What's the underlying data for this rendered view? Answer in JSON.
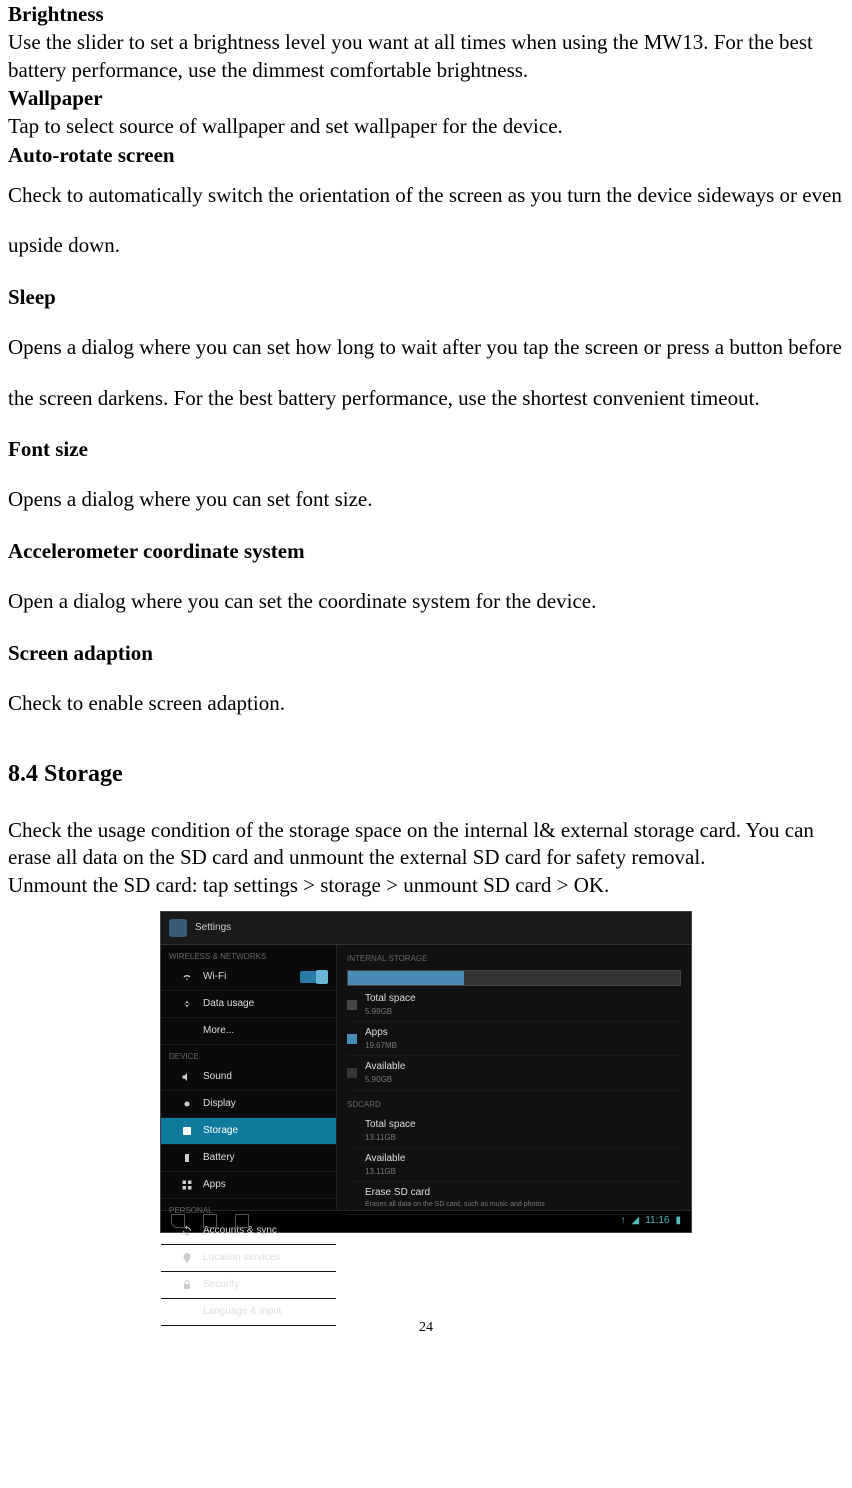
{
  "sections": {
    "brightness": {
      "title": "Brightness",
      "body": "Use the slider to set a brightness level you want at all times when using the MW13. For the best battery performance, use the dimmest comfortable brightness."
    },
    "wallpaper": {
      "title": "Wallpaper",
      "body": "Tap to select source of wallpaper and set wallpaper for the device."
    },
    "auto_rotate": {
      "title": "Auto-rotate screen",
      "body": "Check to automatically switch the orientation of the screen as you turn the device sideways or even upside down."
    },
    "sleep": {
      "title": "Sleep",
      "body": "Opens a dialog where you can set how long to wait after you tap the screen or press a button before the screen darkens. For the best battery performance, use the shortest convenient timeout."
    },
    "font_size": {
      "title": "Font size",
      "body": "Opens a dialog where you can set font size."
    },
    "accel": {
      "title": "Accelerometer coordinate system",
      "body": "Open a dialog where you can set the coordinate system for the device."
    },
    "screen_adaption": {
      "title": "Screen adaption",
      "body": "Check to enable screen adaption."
    }
  },
  "storage": {
    "heading": "8.4 Storage",
    "body": "Check the usage condition of the storage space on the internal l& external storage card. You can erase all data on the SD card and unmount the external SD card for safety removal.",
    "unmount": "Unmount the SD card: tap settings > storage > unmount SD card > OK."
  },
  "screenshot": {
    "header_title": "Settings",
    "sidebar": {
      "cat_wireless": "WIRELESS & NETWORKS",
      "wifi": "Wi-Fi",
      "data_usage": "Data usage",
      "more": "More...",
      "cat_device": "DEVICE",
      "sound": "Sound",
      "display": "Display",
      "storage": "Storage",
      "battery": "Battery",
      "apps": "Apps",
      "cat_personal": "PERSONAL",
      "accounts": "Accounts & sync",
      "location": "Location services",
      "security": "Security",
      "language": "Language & input"
    },
    "main": {
      "cat_internal": "INTERNAL STORAGE",
      "total_label": "Total space",
      "total_value": "5.99GB",
      "apps_label": "Apps",
      "apps_value": "19.67MB",
      "available_label": "Available",
      "available_value": "5.90GB",
      "cat_sdcard": "SDCARD",
      "sd_total_label": "Total space",
      "sd_total_value": "13.11GB",
      "sd_available_label": "Available",
      "sd_available_value": "13.11GB",
      "erase_label": "Erase SD card",
      "erase_desc": "Erases all data on the SD card, such as music and photos"
    },
    "footer": {
      "time": "11:16"
    }
  },
  "page_number": "24"
}
